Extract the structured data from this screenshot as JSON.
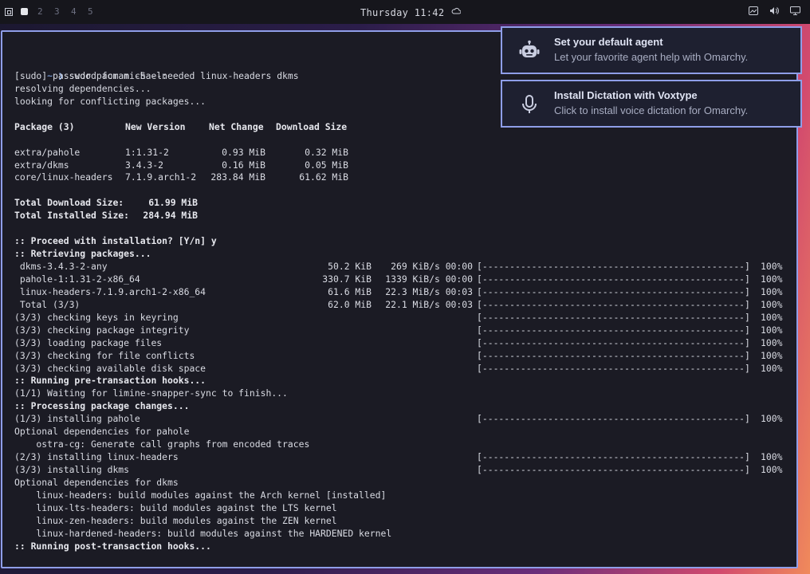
{
  "topbar": {
    "workspaces": [
      "2",
      "3",
      "4",
      "5"
    ],
    "clock": "Thursday 11:42"
  },
  "notifications": [
    {
      "title": "Set your default agent",
      "body": "Let your favorite agent help with Omarchy.",
      "icon": "robot-icon"
    },
    {
      "title": "Install Dictation with Voxtype",
      "body": "Click to install voice dictation for Omarchy.",
      "icon": "microphone-icon"
    }
  ],
  "terminal": {
    "prompt": "~ ❯",
    "command": "sudo pacman -S --needed linux-headers dkms",
    "lines": [
      [
        "[sudo] password for michael:"
      ],
      [
        "resolving dependencies..."
      ],
      [
        "looking for conflicting packages..."
      ],
      [
        ""
      ],
      [
        "Package (3)",
        "New Version",
        "Net Change",
        "Download Size"
      ],
      [
        ""
      ],
      [
        "extra/pahole",
        "1:1.31-2",
        "0.93 MiB",
        "0.32 MiB"
      ],
      [
        "extra/dkms",
        "3.4.3-2",
        "0.16 MiB",
        "0.05 MiB"
      ],
      [
        "core/linux-headers",
        "7.1.9.arch1-2",
        "283.84 MiB",
        "61.62 MiB"
      ],
      [
        ""
      ],
      [
        "Total Download Size:",
        "61.99 MiB"
      ],
      [
        "Total Installed Size:",
        "284.94 MiB"
      ],
      [
        ""
      ],
      [
        ":: Proceed with installation? [Y/n] y"
      ],
      [
        ":: Retrieving packages..."
      ],
      [
        " dkms-3.4.3-2-any",
        "50.2 KiB",
        "269 KiB/s 00:00",
        "[------------------------------------------------]",
        "100%"
      ],
      [
        " pahole-1:1.31-2-x86_64",
        "330.7 KiB",
        "1339 KiB/s 00:00",
        "[------------------------------------------------]",
        "100%"
      ],
      [
        " linux-headers-7.1.9.arch1-2-x86_64",
        "61.6 MiB",
        "22.3 MiB/s 00:03",
        "[------------------------------------------------]",
        "100%"
      ],
      [
        " Total (3/3)",
        "62.0 MiB",
        "22.1 MiB/s 00:03",
        "[------------------------------------------------]",
        "100%"
      ],
      [
        "(3/3) checking keys in keyring",
        "[------------------------------------------------]",
        "100%"
      ],
      [
        "(3/3) checking package integrity",
        "[------------------------------------------------]",
        "100%"
      ],
      [
        "(3/3) loading package files",
        "[------------------------------------------------]",
        "100%"
      ],
      [
        "(3/3) checking for file conflicts",
        "[------------------------------------------------]",
        "100%"
      ],
      [
        "(3/3) checking available disk space",
        "[------------------------------------------------]",
        "100%"
      ],
      [
        ":: Running pre-transaction hooks..."
      ],
      [
        "(1/1) Waiting for limine-snapper-sync to finish..."
      ],
      [
        ":: Processing package changes..."
      ],
      [
        "(1/3) installing pahole",
        "[------------------------------------------------]",
        "100%"
      ],
      [
        "Optional dependencies for pahole"
      ],
      [
        "    ostra-cg: Generate call graphs from encoded traces"
      ],
      [
        "(2/3) installing linux-headers",
        "[------------------------------------------------]",
        "100%"
      ],
      [
        "(3/3) installing dkms",
        "[------------------------------------------------]",
        "100%"
      ],
      [
        "Optional dependencies for dkms"
      ],
      [
        "    linux-headers: build modules against the Arch kernel [installed]"
      ],
      [
        "    linux-lts-headers: build modules against the LTS kernel"
      ],
      [
        "    linux-zen-headers: build modules against the ZEN kernel"
      ],
      [
        "    linux-hardened-headers: build modules against the HARDENED kernel"
      ],
      [
        ":: Running post-transaction hooks..."
      ]
    ]
  },
  "colors": {
    "accent": "#8f9ee8",
    "terminal_bg": "#1b1b24",
    "text": "#d9dbe3"
  }
}
